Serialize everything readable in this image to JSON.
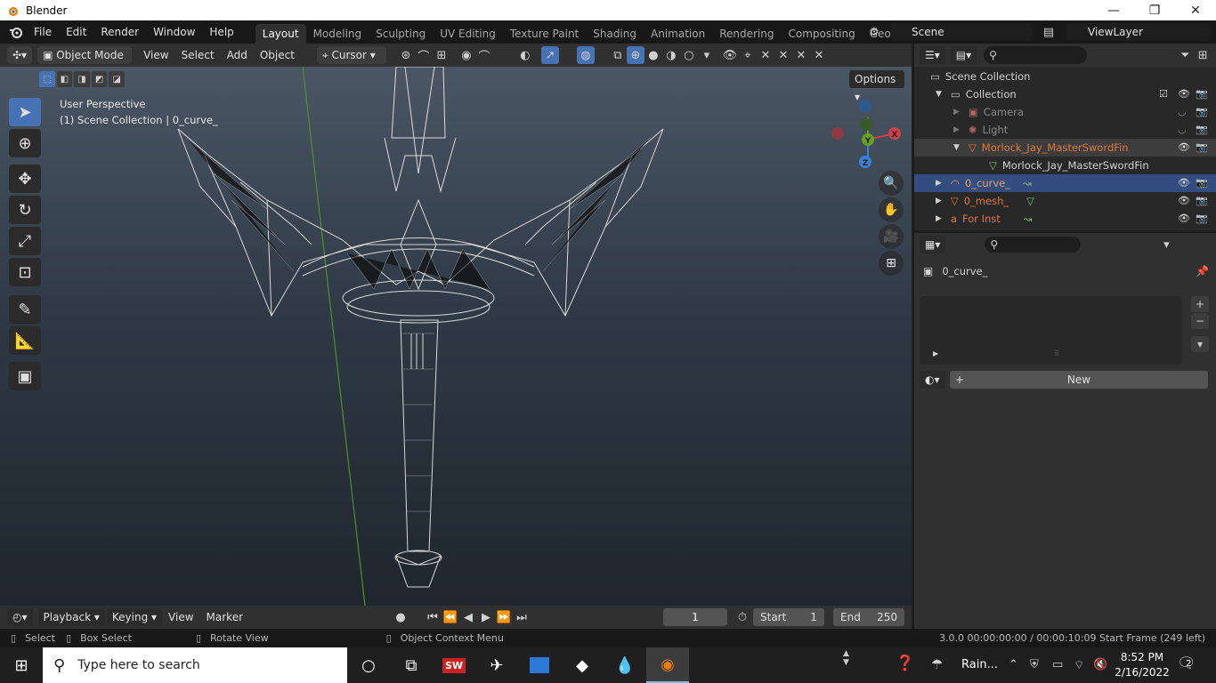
{
  "window": {
    "title": "Blender",
    "controls": {
      "minimize": "—",
      "maximize": "❐",
      "close": "✕"
    }
  },
  "topbar": {
    "menus": [
      "File",
      "Edit",
      "Render",
      "Window",
      "Help"
    ],
    "workspace_tabs": [
      "Layout",
      "Modeling",
      "Sculpting",
      "UV Editing",
      "Texture Paint",
      "Shading",
      "Animation",
      "Rendering",
      "Compositing",
      "Geometry Nod"
    ],
    "active_tab": "Layout",
    "scene": "Scene",
    "view_layer": "ViewLayer"
  },
  "viewport_header": {
    "mode": "Object Mode",
    "menus": [
      "View",
      "Select",
      "Add",
      "Object"
    ],
    "transform_pivot": "Cursor",
    "options_label": "Options"
  },
  "viewport": {
    "perspective_label": "User Perspective",
    "context_label": "(1) Scene Collection | 0_curve_",
    "gizmo_axes": {
      "x": "X",
      "y": "Y",
      "z": "Z"
    }
  },
  "outliner": {
    "rows": [
      {
        "label": "Scene Collection",
        "color": "#d0d0d0"
      },
      {
        "label": "Collection",
        "color": "#d0d0d0"
      },
      {
        "label": "Camera",
        "color": "#8a8a8a"
      },
      {
        "label": "Light",
        "color": "#8a8a8a"
      },
      {
        "label": "Morlock_Jay_MasterSwordFin",
        "color": "#e0793a"
      },
      {
        "label": "Morlock_Jay_MasterSwordFin",
        "color": "#d0d0d0"
      },
      {
        "label": "0_curve_",
        "color": "#e8a060"
      },
      {
        "label": "0_mesh_",
        "color": "#e0793a"
      },
      {
        "label": "For Inst",
        "color": "#e0793a"
      }
    ]
  },
  "properties": {
    "object_name": "0_curve_",
    "new_button": "New"
  },
  "timeline": {
    "menus": [
      "Playback",
      "Keying",
      "View",
      "Marker"
    ],
    "current_frame": "1",
    "start_label": "Start",
    "start_value": "1",
    "end_label": "End",
    "end_value": "250"
  },
  "statusbar": {
    "select": "Select",
    "box_select": "Box Select",
    "rotate_view": "Rotate View",
    "context_menu": "Object Context Menu",
    "info": "3.0.0  00:00:00:00 / 00:00:10:09  Start Frame (249 left)"
  },
  "taskbar": {
    "search_placeholder": "Type here to search",
    "weather": "Rain...",
    "time": "8:52 PM",
    "date": "2/16/2022",
    "notifications": "2"
  },
  "colors": {
    "accent": "#4772b3",
    "selected_row": "#334d80",
    "highlight_row": "#3d3d3d"
  }
}
